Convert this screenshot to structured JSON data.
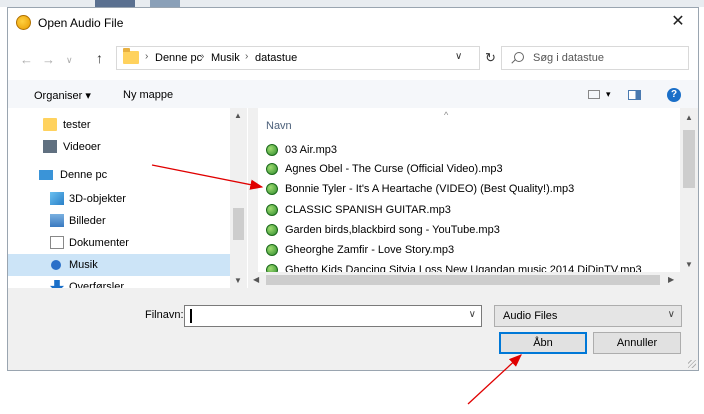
{
  "window": {
    "title": "Open Audio File"
  },
  "address": {
    "crumbs": [
      "Denne pc",
      "Musik",
      "datastue"
    ],
    "search_placeholder": "Søg i datastue"
  },
  "toolbar": {
    "organize": "Organiser ▾",
    "new_folder": "Ny mappe"
  },
  "nav_tree": [
    {
      "label": "tester",
      "icon": "folder-icon"
    },
    {
      "label": "Videoer",
      "icon": "video-folder-icon"
    },
    {
      "label": "Denne pc",
      "icon": "computer-icon"
    },
    {
      "label": "3D-objekter",
      "icon": "3d-objects-icon"
    },
    {
      "label": "Billeder",
      "icon": "pictures-icon"
    },
    {
      "label": "Dokumenter",
      "icon": "documents-icon"
    },
    {
      "label": "Musik",
      "icon": "music-icon",
      "selected": true
    },
    {
      "label": "Overførsler",
      "icon": "downloads-icon"
    }
  ],
  "file_list": {
    "column_header": "Navn",
    "files": [
      "03 Air.mp3",
      "Agnes Obel - The Curse (Official Video).mp3",
      "Bonnie Tyler - It's A Heartache (VIDEO) (Best Quality!).mp3",
      "CLASSIC SPANISH GUITAR.mp3",
      "Garden birds,blackbird song - YouTube.mp3",
      "Gheorghe Zamfir - Love Story.mp3",
      "Ghetto Kids Dancing Sityja Loss New Ugandan music 2014 DjDinTV.mp3"
    ]
  },
  "bottom": {
    "filename_label": "Filnavn:",
    "filename_value": "",
    "file_type": "Audio Files",
    "open_button": "Åbn",
    "cancel_button": "Annuller"
  },
  "annotations": {
    "arrow_color": "#e00000"
  }
}
